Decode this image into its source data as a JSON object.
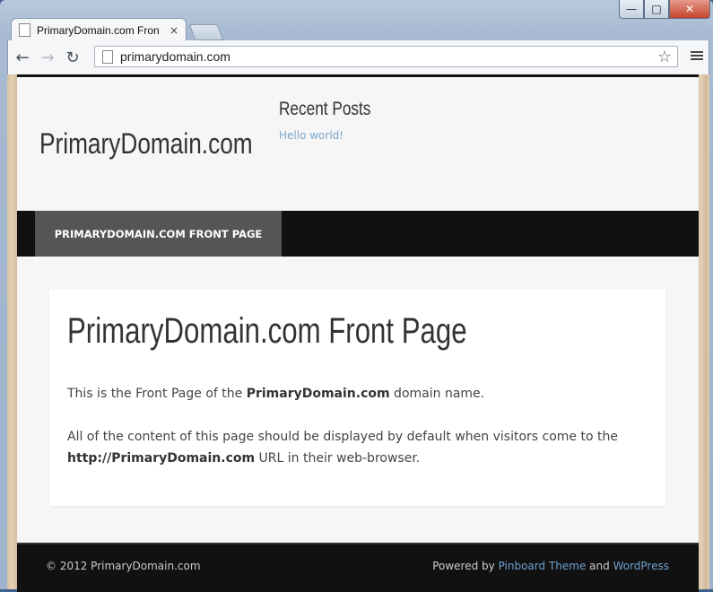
{
  "browser": {
    "tab_title": "PrimaryDomain.com Fron",
    "tab_close": "×",
    "url": "primarydomain.com",
    "window_controls": {
      "minimize": "—",
      "maximize": "□",
      "close": "✕"
    }
  },
  "site": {
    "title": "PrimaryDomain.com",
    "widget": {
      "title": "Recent Posts",
      "link": "Hello world!"
    },
    "nav": {
      "item": "PRIMARYDOMAIN.COM FRONT PAGE"
    },
    "content": {
      "heading": "PrimaryDomain.com Front Page",
      "p1_pre": "This is the Front Page of the ",
      "p1_bold": "PrimaryDomain.com",
      "p1_post": " domain name.",
      "p2_pre": "All of the content of this page should be displayed by default when visitors come to the ",
      "p2_bold": "http://PrimaryDomain.com",
      "p2_post": " URL in their web-browser."
    },
    "footer": {
      "copyright": "© 2012 PrimaryDomain.com",
      "powered_pre": "Powered by ",
      "powered_link1": "Pinboard Theme",
      "powered_mid": " and ",
      "powered_link2": "WordPress"
    }
  },
  "colors": {
    "nav_bg": "#111111",
    "nav_active": "#555555",
    "link": "#7aa5c9"
  }
}
